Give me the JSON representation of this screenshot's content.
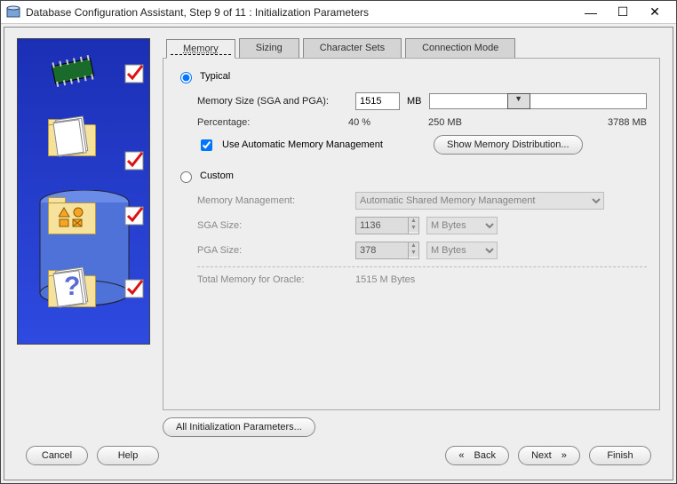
{
  "window": {
    "title": "Database Configuration Assistant, Step 9 of 11 : Initialization Parameters"
  },
  "tabs": {
    "memory": "Memory",
    "sizing": "Sizing",
    "charsets": "Character Sets",
    "connmode": "Connection Mode"
  },
  "typical": {
    "label": "Typical",
    "memory_label": "Memory Size (SGA and PGA):",
    "memory_value": "1515",
    "memory_unit": "MB",
    "percentage_label": "Percentage:",
    "percentage_value": "40 %",
    "min_mb": "250 MB",
    "max_mb": "3788 MB",
    "use_auto_label": "Use Automatic Memory Management",
    "show_dist_btn": "Show Memory Distribution..."
  },
  "custom": {
    "label": "Custom",
    "mm_label": "Memory Management:",
    "mm_value": "Automatic Shared Memory Management",
    "sga_label": "SGA Size:",
    "sga_value": "1136",
    "pga_label": "PGA Size:",
    "pga_value": "378",
    "unit": "M Bytes",
    "total_label": "Total Memory for Oracle:",
    "total_value": "1515 M Bytes"
  },
  "bottom": {
    "all_params": "All Initialization Parameters..."
  },
  "footer": {
    "cancel": "Cancel",
    "help": "Help",
    "back": "Back",
    "next": "Next",
    "finish": "Finish"
  }
}
